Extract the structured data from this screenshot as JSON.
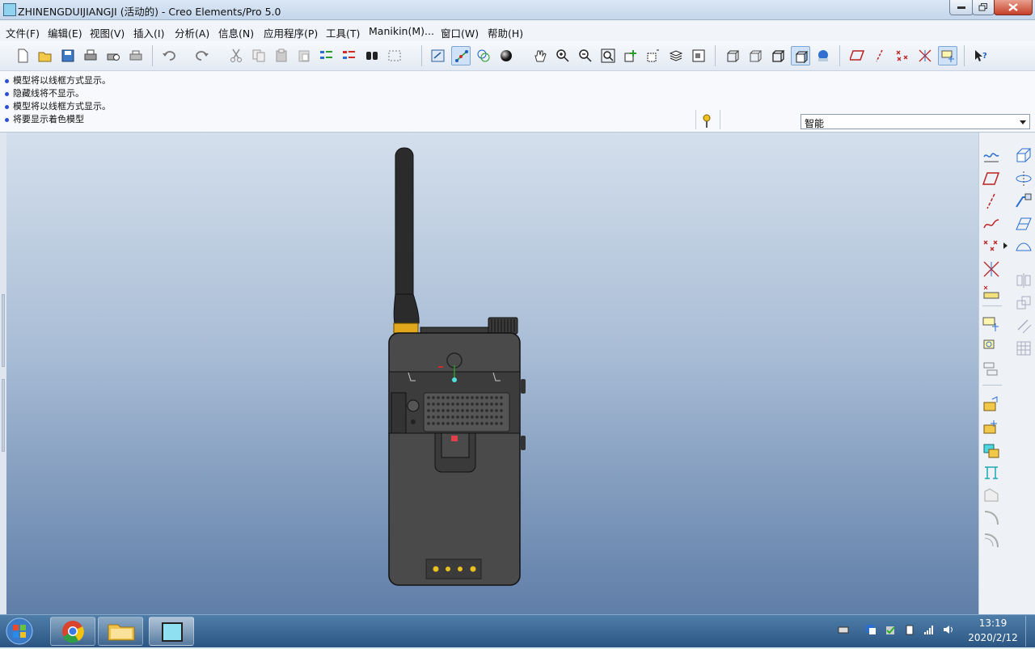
{
  "window": {
    "title": "ZHINENGDUIJIANGJI (活动的) - Creo Elements/Pro 5.0"
  },
  "menu": [
    "文件(F)",
    "编辑(E)",
    "视图(V)",
    "插入(I)",
    "分析(A)",
    "信息(N)",
    "应用程序(P)",
    "工具(T)",
    "Manikin(M)...",
    "窗口(W)",
    "帮助(H)"
  ],
  "messages": [
    "模型将以线框方式显示。",
    "隐藏线将不显示。",
    "模型将以线框方式显示。",
    "将要显示着色模型"
  ],
  "filter": {
    "selected": "智能"
  },
  "clock": {
    "time": "13:19",
    "date": "2020/2/12"
  },
  "colors": {
    "accent": "#3a7bd5",
    "viewport_top": "#d4dfec",
    "viewport_bottom": "#5f7ea8",
    "model_body": "#4a4a4a",
    "antenna_band": "#e0a81a"
  },
  "toolbar_icons": [
    "new-icon",
    "open-icon",
    "save-icon",
    "print-icon",
    "print-preview-icon",
    "quick-print-icon",
    "undo-icon",
    "redo-icon",
    "cut-icon",
    "copy-icon",
    "paste-icon",
    "paste-special-icon",
    "regenerate-icon",
    "regen-manager-icon",
    "find-icon",
    "select-box-icon",
    "repaint-icon",
    "spin-center-icon",
    "orient-mode-icon",
    "display-style-icon",
    "pan-icon",
    "zoom-in-icon",
    "zoom-out-icon",
    "refit-icon",
    "reorient-icon",
    "named-views-icon",
    "layers-icon",
    "view-manager-icon",
    "wireframe-icon",
    "hidden-line-icon",
    "no-hidden-icon",
    "shading-icon",
    "appearance-icon",
    "datum-planes-icon",
    "datum-axes-icon",
    "datum-points-icon",
    "coord-sys-icon",
    "annotation-icon",
    "whats-this-icon"
  ]
}
